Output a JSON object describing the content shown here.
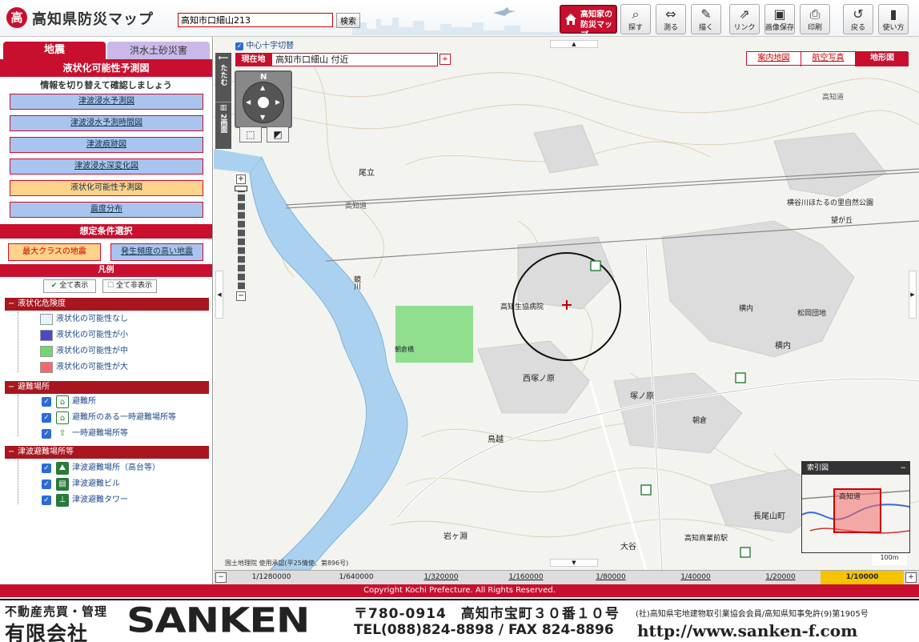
{
  "header": {
    "logo_glyph": "高",
    "title": "高知県防災マップ",
    "search_value": "高知市口細山213",
    "search_button": "検索",
    "home_button": [
      "高知家の",
      "防災マップ"
    ],
    "tools": [
      {
        "label": "探す",
        "icon": "search-icon",
        "glyph": "🔍"
      },
      {
        "label": "測る",
        "icon": "measure-icon",
        "glyph": "⇔"
      },
      {
        "label": "描く",
        "icon": "draw-icon",
        "glyph": "✎"
      },
      {
        "label": "リンク",
        "icon": "link-icon",
        "glyph": "⇗"
      },
      {
        "label": "画像保存",
        "icon": "image-save-icon",
        "glyph": "▣"
      },
      {
        "label": "印刷",
        "icon": "print-icon",
        "glyph": "⎙"
      },
      {
        "label": "戻る",
        "icon": "back-icon",
        "glyph": "↺"
      },
      {
        "label": "使い方",
        "icon": "help-icon",
        "glyph": "?"
      }
    ]
  },
  "sidebar": {
    "tab_earthquake": "地震",
    "tab_flood": "洪水土砂災害",
    "panel_title": "液状化可能性予測図",
    "instruction": "情報を切り替えて確認しましょう",
    "map_buttons": [
      {
        "label": "津波浸水予測図",
        "active": false
      },
      {
        "label": "津波浸水予測時間図",
        "active": false
      },
      {
        "label": "津波痕跡図",
        "active": false
      },
      {
        "label": "津波浸水深変化図",
        "active": false
      },
      {
        "label": "液状化可能性予測図",
        "active": true
      },
      {
        "label": "震度分布",
        "active": false
      }
    ],
    "condition_title": "想定条件選択",
    "condition_max": "最大クラスの地震",
    "condition_freq": "発生頻度の高い地震",
    "legend_title": "凡例",
    "show_all": "全て表示",
    "hide_all": "全て非表示",
    "groups": {
      "liquefaction": {
        "title": "液状化危険度",
        "items": [
          {
            "label": "液状化の可能性なし",
            "color": "#e6f5fb"
          },
          {
            "label": "液状化の可能性が小",
            "color": "#4a4acb"
          },
          {
            "label": "液状化の可能性が中",
            "color": "#6ed86e"
          },
          {
            "label": "液状化の可能性が大",
            "color": "#f46a6a"
          }
        ]
      },
      "shelter": {
        "title": "避難場所",
        "items": [
          {
            "label": "避難所",
            "icon": "shelter-icon"
          },
          {
            "label": "避難所のある一時避難場所等",
            "icon": "shelter-temp-icon"
          },
          {
            "label": "一時避難場所等",
            "icon": "temp-evac-icon"
          }
        ]
      },
      "tsunami": {
        "title": "津波避難場所等",
        "items": [
          {
            "label": "津波避難場所（高台等）",
            "icon": "tsunami-high-icon"
          },
          {
            "label": "津波避難ビル",
            "icon": "tsunami-building-icon"
          },
          {
            "label": "津波避難タワー",
            "icon": "tsunami-tower-icon"
          }
        ]
      }
    }
  },
  "map": {
    "center_toggle": "中心十字切替",
    "side_fold": "たたむ",
    "side_split": "2画面",
    "current_label": "現在地",
    "current_value": "高知市口細山 付近",
    "map_types": [
      "案内地図",
      "航空写真",
      "地形図"
    ],
    "active_map_type": "地形図",
    "place_labels": [
      {
        "text": "尾立"
      },
      {
        "text": "高知道"
      },
      {
        "text": "高知道"
      },
      {
        "text": "横谷川ほたるの里自然公園"
      },
      {
        "text": "望が丘"
      },
      {
        "text": "高知生協病院"
      },
      {
        "text": "横内"
      },
      {
        "text": "松岡団地"
      },
      {
        "text": "横内"
      },
      {
        "text": "西塚ノ原"
      },
      {
        "text": "塚ノ原"
      },
      {
        "text": "朝倉"
      },
      {
        "text": "鳥越"
      },
      {
        "text": "長尾山町"
      },
      {
        "text": "大谷"
      },
      {
        "text": "岩ヶ淵"
      },
      {
        "text": "高知商業前駅"
      },
      {
        "text": "鏡川"
      },
      {
        "text": "朝倉橋"
      }
    ],
    "overview_title": "索引図",
    "overview_label": "高知道",
    "scalebar": "100m",
    "attribution": "国土地理院 使用承認(平25情使、第896号)",
    "scales": [
      "1/1280000",
      "1/640000",
      "1/320000",
      "1/160000",
      "1/80000",
      "1/40000",
      "1/20000",
      "1/10000"
    ],
    "active_scale": "1/10000"
  },
  "copyright": "Copyright Kochi Prefecture. All Rights Reserved.",
  "footer": {
    "line1": "不動産売買・管理",
    "line2": "有限会社",
    "logo": "SANKEN",
    "address": "〒780-0914　高知市宝町３０番１０号",
    "association": "(社)高知県宅地建物取引業協会会員/高知県知事免許(9)第1905号",
    "tel": "TEL(088)824-8898 / FAX 824-8896",
    "url": "http://www.sanken-f.com"
  },
  "colors": {
    "brand_red": "#c8102e",
    "button_blue": "#a9c4ee",
    "button_orange": "#fdd28a",
    "river": "#aad2f0",
    "liquefaction_mid": "#6ed86e"
  }
}
